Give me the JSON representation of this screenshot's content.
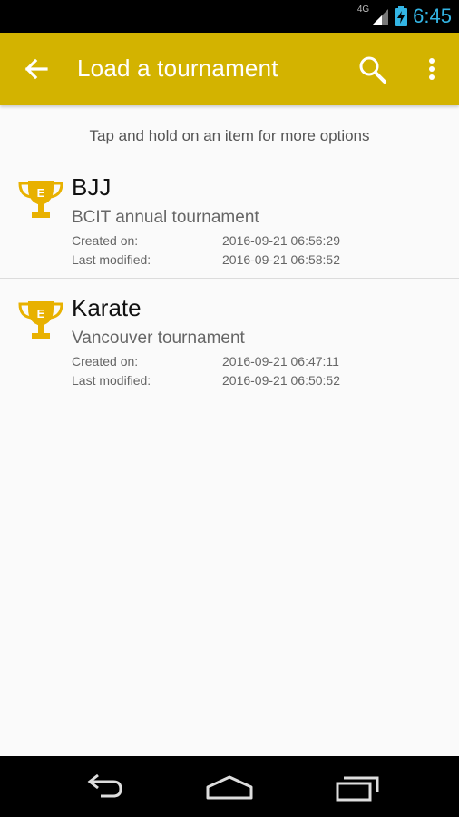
{
  "status_bar": {
    "network": "4G",
    "time": "6:45"
  },
  "app_bar": {
    "title": "Load a tournament",
    "icons": [
      "arrow-back-icon",
      "search-icon",
      "more-vert-icon"
    ]
  },
  "hint": "Tap and hold on an item for more options",
  "tournaments": [
    {
      "name": "BJJ",
      "description": "BCIT annual tournament",
      "created_label": "Created on:",
      "created": "2016-09-21 06:56:29",
      "modified_label": "Last modified:",
      "modified": "2016-09-21 06:58:52"
    },
    {
      "name": "Karate",
      "description": "Vancouver tournament",
      "created_label": "Created on:",
      "created": "2016-09-21 06:47:11",
      "modified_label": "Last modified:",
      "modified": "2016-09-21 06:50:52"
    }
  ],
  "nav_bar": {
    "icons": [
      "nav-back-icon",
      "nav-home-icon",
      "nav-recents-icon"
    ]
  },
  "colors": {
    "app_bar": "#d3b300",
    "trophy": "#e8b100",
    "clock": "#33b5e5"
  }
}
